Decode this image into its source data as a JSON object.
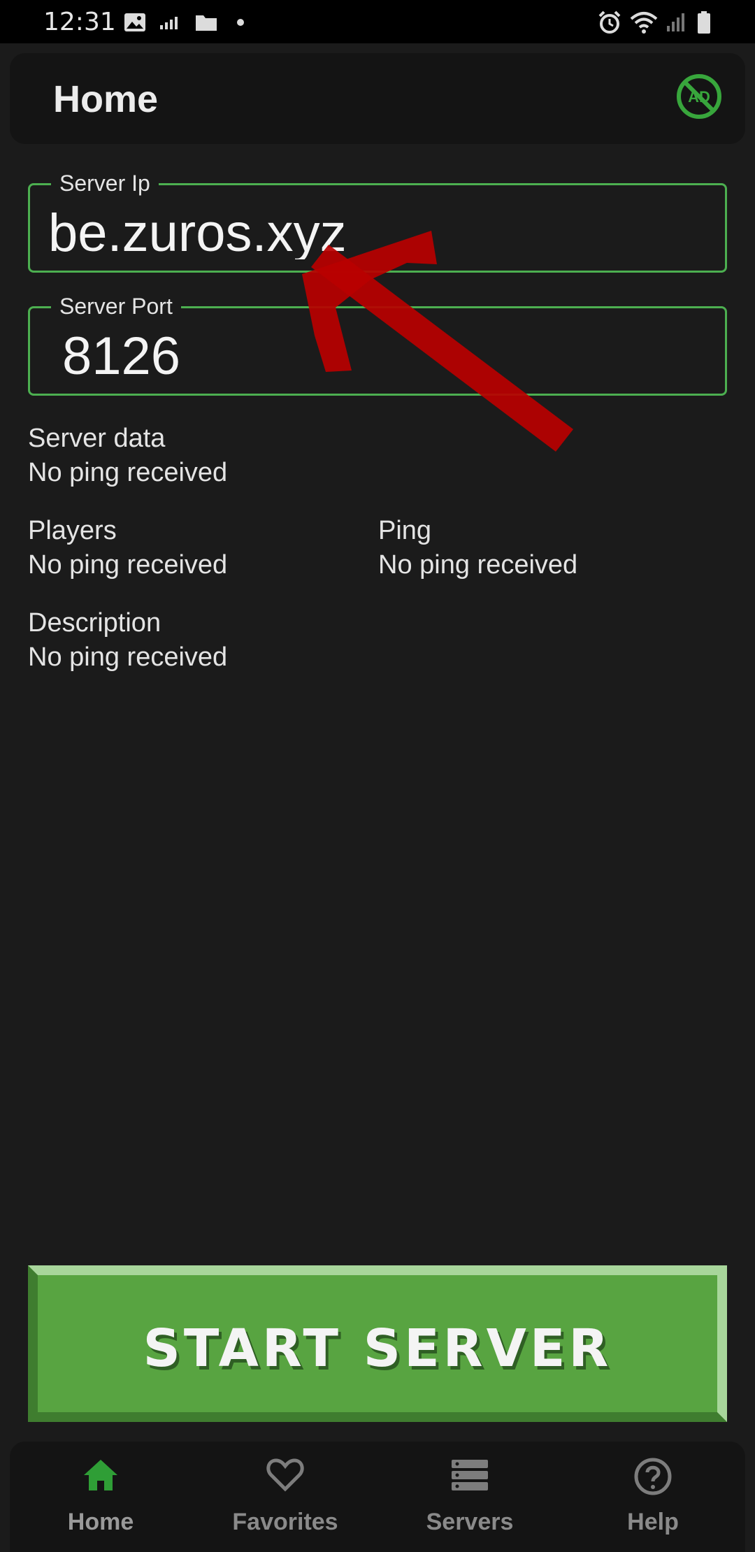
{
  "status_bar": {
    "time": "12:31"
  },
  "header": {
    "title": "Home",
    "ad_icon_text": "AD"
  },
  "form": {
    "server_ip_label": "Server Ip",
    "server_ip_value": "be.zuros.xyz",
    "server_port_label": "Server Port",
    "server_port_value": "8126"
  },
  "info": {
    "server_data_label": "Server data",
    "server_data_value": "No ping received",
    "players_label": "Players",
    "players_value": "No ping received",
    "ping_label": "Ping",
    "ping_value": "No ping received",
    "description_label": "Description",
    "description_value": "No ping received"
  },
  "actions": {
    "start_label": "START SERVER"
  },
  "bottom_nav": {
    "items": [
      {
        "label": "Home",
        "icon": "home-icon",
        "active": true
      },
      {
        "label": "Favorites",
        "icon": "heart-icon",
        "active": false
      },
      {
        "label": "Servers",
        "icon": "servers-icon",
        "active": false
      },
      {
        "label": "Help",
        "icon": "help-icon",
        "active": false
      }
    ]
  },
  "colors": {
    "accent_green": "#4caf50",
    "button_green": "#58a441",
    "background": "#1b1b1b",
    "annotation_arrow": "#b80000"
  }
}
